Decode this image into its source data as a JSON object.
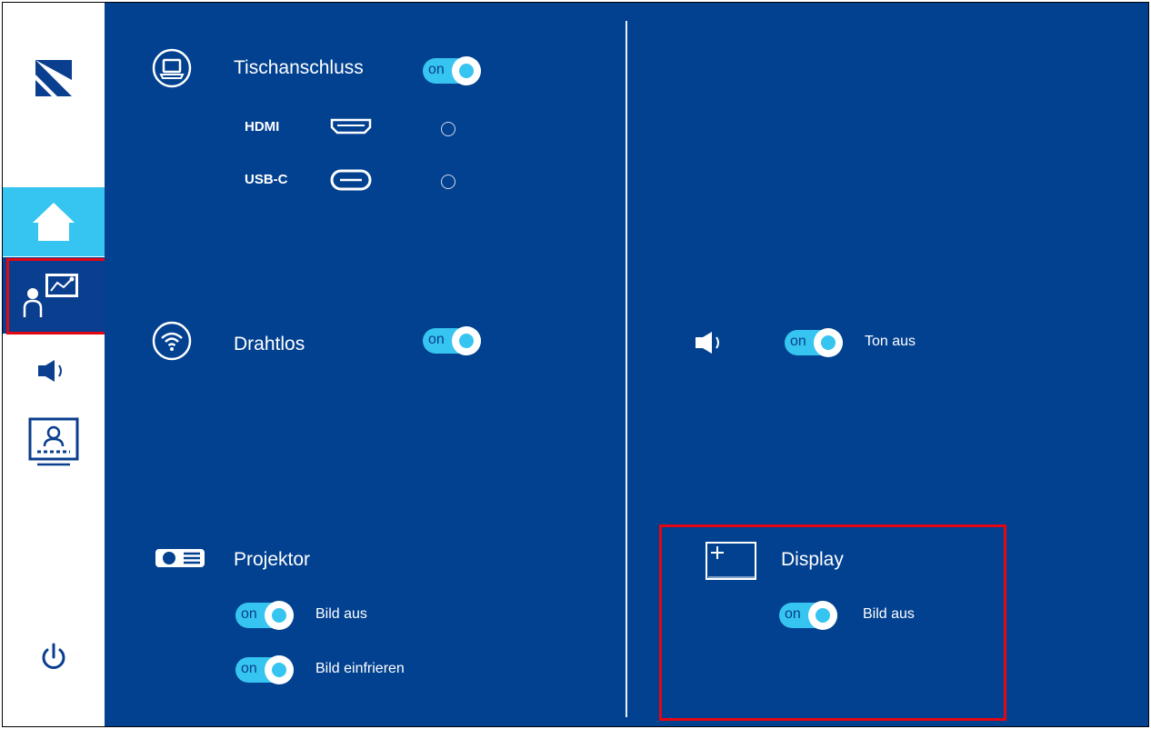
{
  "sidebar": {
    "items": [
      {
        "name": "logo",
        "icon": "logo-icon"
      },
      {
        "name": "home",
        "icon": "home-icon",
        "active": true
      },
      {
        "name": "presenter",
        "icon": "presenter-chart-icon",
        "selected": true
      },
      {
        "name": "audio",
        "icon": "speaker-icon"
      },
      {
        "name": "video-conference",
        "icon": "video-conference-icon"
      },
      {
        "name": "power",
        "icon": "power-icon"
      }
    ]
  },
  "table_connection": {
    "icon": "laptop-icon",
    "title": "Tischanschluss",
    "toggle_label": "on",
    "inputs": [
      {
        "label": "HDMI",
        "icon": "hdmi-port-icon",
        "selected": false
      },
      {
        "label": "USB-C",
        "icon": "usbc-port-icon",
        "selected": false
      }
    ]
  },
  "wireless": {
    "icon": "wifi-icon",
    "title": "Drahtlos",
    "toggle_label": "on"
  },
  "audio": {
    "icon": "speaker-icon",
    "toggle_label": "on",
    "label": "Ton aus"
  },
  "projector": {
    "icon": "projector-icon",
    "title": "Projektor",
    "options": [
      {
        "toggle_label": "on",
        "label": "Bild aus"
      },
      {
        "toggle_label": "on",
        "label": "Bild einfrieren"
      }
    ]
  },
  "display": {
    "icon": "display-icon",
    "title": "Display",
    "option": {
      "toggle_label": "on",
      "label": "Bild aus"
    }
  },
  "colors": {
    "panel_bg": "#024190",
    "accent": "#36c5f0",
    "sidebar_active": "#36c5f0",
    "sidebar_selected": "#0a3e8e",
    "highlight": "#e30613"
  }
}
